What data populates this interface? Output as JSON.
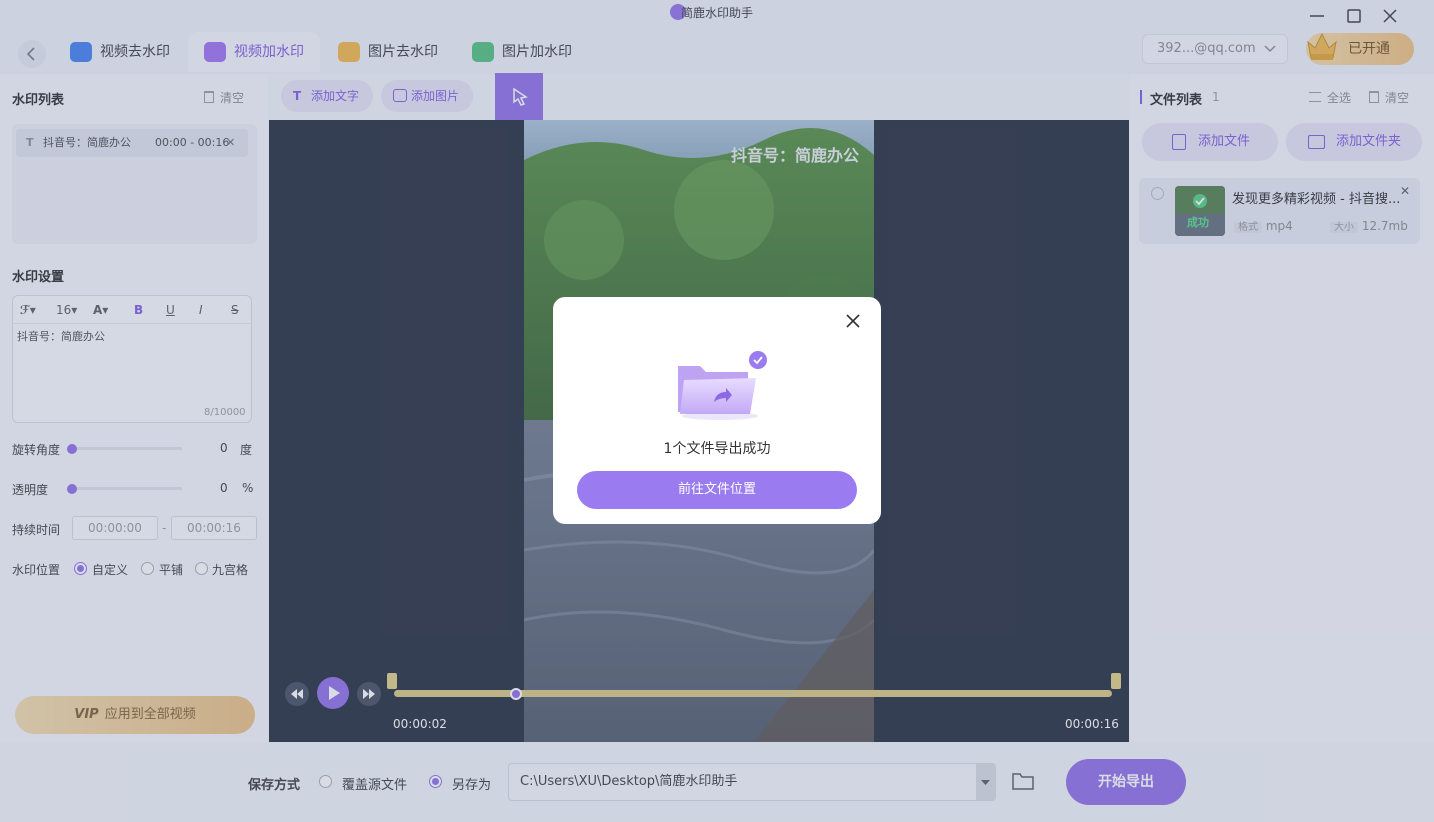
{
  "app": {
    "title": "简鹿水印助手"
  },
  "tabs": [
    {
      "label": "视频去水印",
      "icon": "video-remove-icon"
    },
    {
      "label": "视频加水印",
      "icon": "video-add-icon",
      "active": true
    },
    {
      "label": "图片去水印",
      "icon": "image-remove-icon"
    },
    {
      "label": "图片加水印",
      "icon": "image-add-icon"
    }
  ],
  "account": {
    "email": "392...@qq.com",
    "vip_label": "已开通"
  },
  "left": {
    "list_title": "水印列表",
    "clear_label": "清空",
    "items": [
      {
        "text": "抖音号：简鹿办公",
        "range": "00:00 - 00:16"
      }
    ],
    "settings_title": "水印设置",
    "font_size": "16",
    "text_value": "抖音号：简鹿办公",
    "char_count": "8/10000",
    "rotation_label": "旋转角度",
    "rotation_value": "0",
    "rotation_unit": "度",
    "opacity_label": "透明度",
    "opacity_value": "0",
    "opacity_unit": "%",
    "duration_label": "持续时间",
    "start_time": "00:00:00",
    "end_time": "00:00:16",
    "time_sep": "-",
    "position_label": "水印位置",
    "position_options": [
      "自定义",
      "平铺",
      "九宫格"
    ],
    "apply_vip": "VIP",
    "apply_label": "应用到全部视频"
  },
  "toolbar": {
    "add_text": "添加文字",
    "add_image": "添加图片"
  },
  "video": {
    "watermark": "抖音号：简鹿办公",
    "current_time": "00:00:02",
    "end_time": "00:00:16",
    "progress_fraction": 0.17
  },
  "right": {
    "title": "文件列表",
    "count": "1",
    "select_all": "全选",
    "clear": "清空",
    "add_file": "添加文件",
    "add_folder": "添加文件夹",
    "file": {
      "name": "发现更多精彩视频 - 抖音搜...",
      "status": "成功",
      "format_tag": "格式",
      "format": "mp4",
      "size_tag": "大小",
      "size": "12.7mb"
    }
  },
  "bottom": {
    "save_label": "保存方式",
    "overwrite": "覆盖源文件",
    "save_as": "另存为",
    "path": "C:\\Users\\XU\\Desktop\\简鹿水印助手",
    "export": "开始导出"
  },
  "modal": {
    "message": "1个文件导出成功",
    "button": "前往文件位置"
  },
  "colors": {
    "accent": "#8c6ae6",
    "stage": "#1d2637",
    "vip_gold": "#efc07a"
  }
}
